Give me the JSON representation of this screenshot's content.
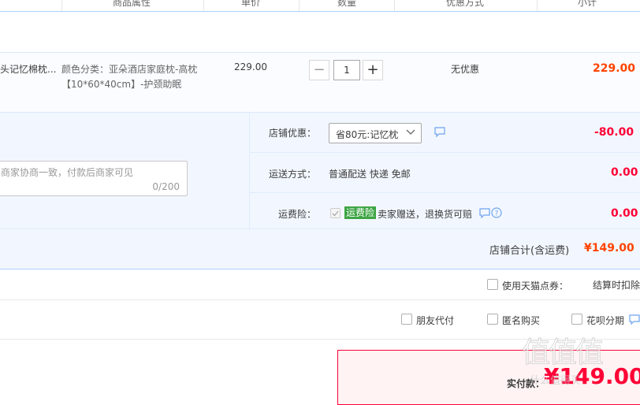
{
  "header": {
    "columns": [
      "商品属性",
      "单价",
      "数量",
      "优惠方式",
      "小计"
    ]
  },
  "item": {
    "title": "头记忆棉枕...",
    "attrs_line1": "颜色分类：亚朵酒店家庭枕-高枕",
    "attrs_line2": "【10*60*40cm】-护颈助眠",
    "unit_price": "229.00",
    "quantity": "1",
    "minus": "−",
    "plus": "+",
    "discount_method": "无优惠",
    "subtotal": "229.00"
  },
  "shop": {
    "discount_label": "店铺优惠：",
    "discount_selected": "省80元:记忆枕",
    "discount_amount": "-80.00",
    "shipping_label": "运送方式：",
    "shipping_value": "普通配送 快递 免邮",
    "shipping_amount": "0.00",
    "insurance_label": "运费险：",
    "insurance_tag": "运费险",
    "insurance_desc": "卖家赠送，退换货可赔",
    "insurance_amount": "0.00",
    "total_label": "店铺合计(含运费)",
    "total_value": "¥149.00"
  },
  "message": {
    "placeholder": "商家协商一致，付款后商家可见",
    "counter": "0/200"
  },
  "options": {
    "tmall_points_label": "使用天猫点券：",
    "tmall_points_hint": "结算时扣除",
    "friend_pay": "朋友代付",
    "anonymous": "匿名购买",
    "huabei": "花呗分期"
  },
  "payment": {
    "label": "实付款：",
    "amount": "¥149.00"
  },
  "watermark": "值 值 值 · 什么值得买",
  "colors": {
    "accent_blue": "#b2d1ff",
    "price_orange": "#ff4400",
    "price_red": "#ff0036",
    "insurance_green": "#3ea544"
  }
}
